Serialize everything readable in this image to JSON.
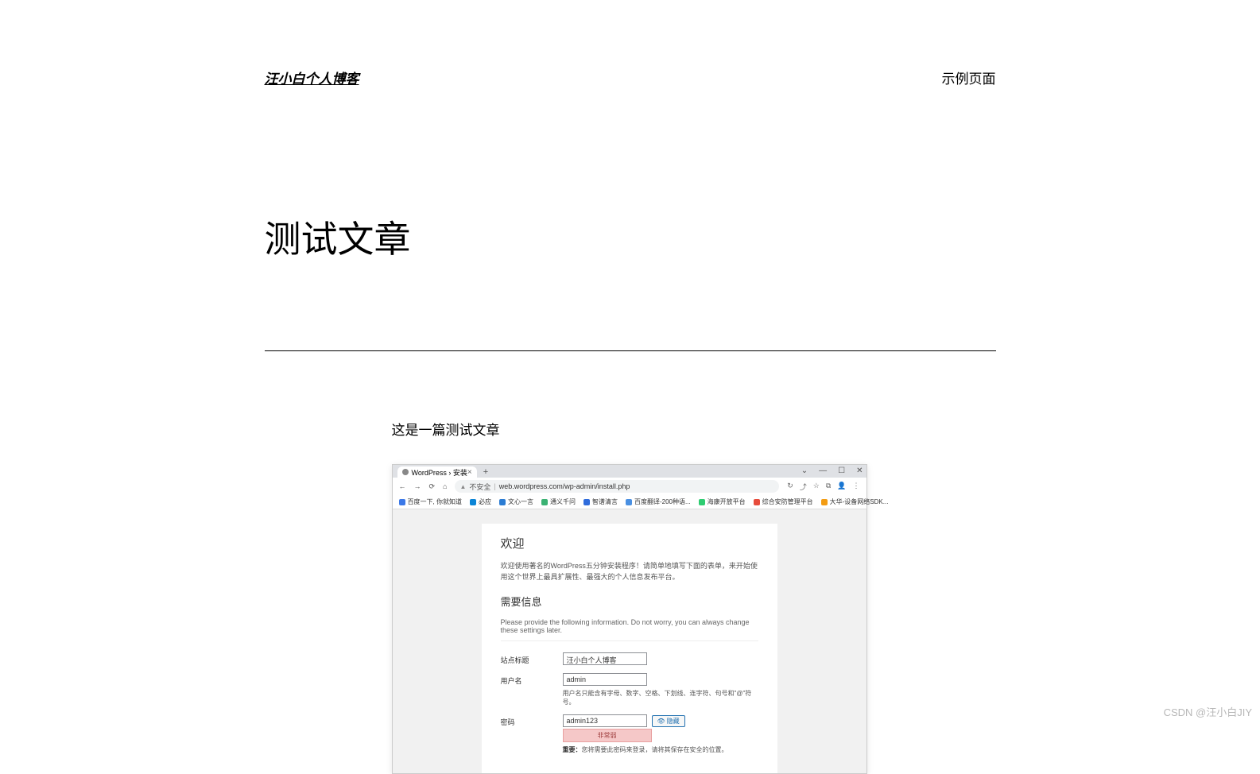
{
  "header": {
    "site_title": "汪小白个人博客",
    "nav_link": "示例页面"
  },
  "post": {
    "title": "测试文章",
    "intro": "这是一篇测试文章"
  },
  "browser": {
    "tab_title": "WordPress › 安装",
    "window_controls": {
      "dropdown": "⌄",
      "min": "—",
      "max": "☐",
      "close": "✕"
    },
    "address": {
      "back": "←",
      "forward": "→",
      "reload": "⟳",
      "home": "⌂",
      "security_label": "不安全",
      "url": "web.wordpress.com/wp-admin/install.php",
      "right_icons": [
        "↻",
        "⤴",
        "☆",
        "⧉",
        "👤",
        "⋮"
      ]
    },
    "bookmarks": [
      {
        "icon": "#3b78e7",
        "label": "百度一下, 你就知道"
      },
      {
        "icon": "#0a84d6",
        "label": "必应"
      },
      {
        "icon": "#2b7cd3",
        "label": "文心一言"
      },
      {
        "icon": "#3bb273",
        "label": "通义千问"
      },
      {
        "icon": "#2f6cdc",
        "label": "智谱清言"
      },
      {
        "icon": "#4a90e2",
        "label": "百度翻译-200种语..."
      },
      {
        "icon": "#2ecc71",
        "label": "海康开放平台"
      },
      {
        "icon": "#e74c3c",
        "label": "综合安防管理平台"
      },
      {
        "icon": "#f39c12",
        "label": "大华-设备网络SDK..."
      }
    ],
    "install": {
      "welcome_title": "欢迎",
      "welcome_desc": "欢迎使用著名的WordPress五分钟安装程序！请简单地填写下面的表单，来开始使用这个世界上最具扩展性、最强大的个人信息发布平台。",
      "info_title": "需要信息",
      "info_note": "Please provide the following information. Do not worry, you can always change these settings later.",
      "fields": {
        "site_title_label": "站点标题",
        "site_title_value": "汪小白个人博客",
        "username_label": "用户名",
        "username_value": "admin",
        "username_hint": "用户名只能含有字母、数字、空格、下划线、连字符、句号和\"@\"符号。",
        "password_label": "密码",
        "password_value": "admin123",
        "hide_btn": "隐藏",
        "strength": "非常弱",
        "pw_warn_prefix": "重要：",
        "pw_warn_text": "您将需要此密码来登录，请将其保存在安全的位置。"
      }
    }
  },
  "watermark": "CSDN @汪小白JIY"
}
